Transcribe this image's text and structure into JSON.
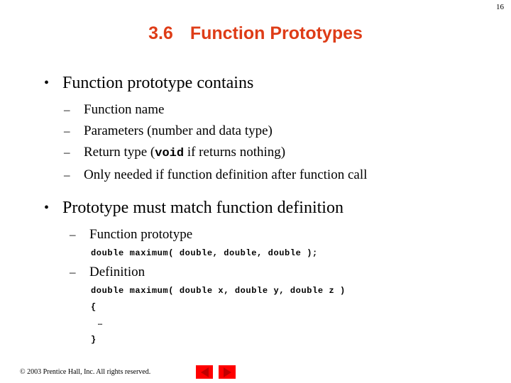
{
  "page_number": "16",
  "title": {
    "number": "3.6",
    "text": "Function Prototypes",
    "color": "#DE3C17"
  },
  "sections": [
    {
      "bullet": "Function prototype contains",
      "bullet_marker": "•",
      "items": [
        {
          "marker": "–",
          "pre": "Function name",
          "mono": "",
          "post": ""
        },
        {
          "marker": "–",
          "pre": "Parameters (number and data type)",
          "mono": "",
          "post": ""
        },
        {
          "marker": "–",
          "pre": "Return type (",
          "mono": "void",
          "post": " if returns nothing)"
        },
        {
          "marker": "–",
          "pre": "Only needed if function definition after function call",
          "mono": "",
          "post": ""
        }
      ]
    },
    {
      "bullet": "Prototype must match function definition",
      "bullet_marker": "•",
      "items": [
        {
          "marker": "–",
          "pre": "Function prototype",
          "mono": "",
          "post": ""
        },
        {
          "marker": "–",
          "pre": "Definition",
          "mono": "",
          "post": ""
        }
      ]
    }
  ],
  "code": {
    "prototype": "double maximum( double, double, double );",
    "definition_signature": "double maximum( double x, double y, double z )",
    "open_brace": "{",
    "body_ellipsis": "…",
    "close_brace": "}"
  },
  "footer": {
    "copyright": "© 2003 Prentice Hall, Inc.  All rights reserved.",
    "prev_label": "Previous slide",
    "next_label": "Next slide"
  }
}
